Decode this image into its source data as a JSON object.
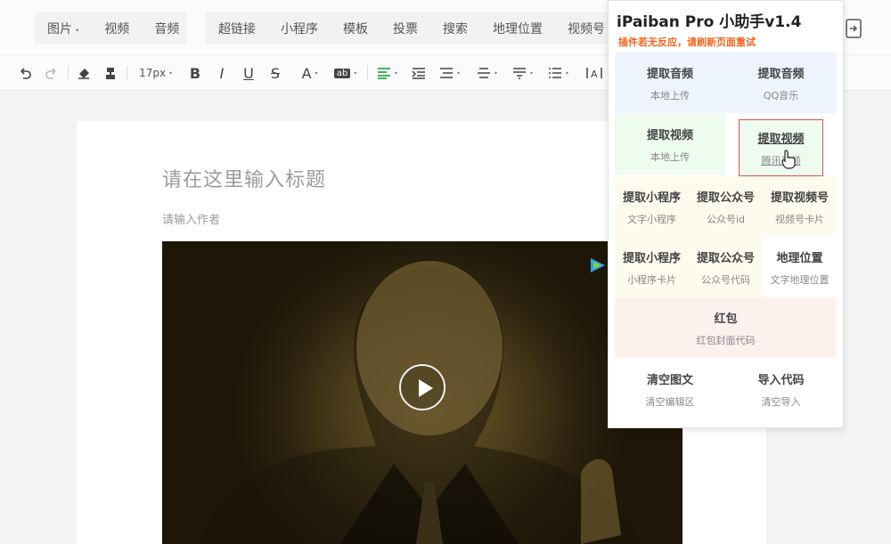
{
  "topbar": {
    "group1": [
      {
        "label": "图片",
        "dropdown": true
      },
      {
        "label": "视频",
        "dropdown": false
      },
      {
        "label": "音频",
        "dropdown": false
      }
    ],
    "group2": [
      {
        "label": "超链接"
      },
      {
        "label": "小程序"
      },
      {
        "label": "模板"
      },
      {
        "label": "投票"
      },
      {
        "label": "搜索"
      },
      {
        "label": "地理位置"
      },
      {
        "label": "视频号"
      }
    ],
    "right_icon": "document-icon"
  },
  "format_toolbar": {
    "font_size": "17px",
    "bold": "B",
    "italic": "I",
    "underline": "U",
    "strike": "S",
    "font_color": "A",
    "highlight": "ab"
  },
  "editor": {
    "title_placeholder": "请在这里输入标题",
    "author_placeholder": "请输入作者"
  },
  "popup": {
    "title": "iPaiban Pro 小助手v1.4",
    "warning": "插件若无反应，请刷新页面重试",
    "warning_color": "#f0641e",
    "rows": [
      [
        {
          "main": "提取音频",
          "sub": "本地上传"
        },
        {
          "main": "提取音频",
          "sub": "QQ音乐"
        }
      ],
      [
        {
          "main": "提取视频",
          "sub": "本地上传"
        },
        {
          "main": "提取视频",
          "sub": "腾讯视频"
        }
      ],
      [
        {
          "main": "提取小程序",
          "sub": "文字小程序"
        },
        {
          "main": "提取公众号",
          "sub": "公众号id"
        },
        {
          "main": "提取视频号",
          "sub": "视频号卡片"
        }
      ],
      [
        {
          "main": "提取小程序",
          "sub": "小程序卡片"
        },
        {
          "main": "提取公众号",
          "sub": "公众号代码"
        },
        {
          "main": "地理位置",
          "sub": "文字地理位置"
        }
      ],
      [
        {
          "main": "红包",
          "sub": "红包封面代码"
        }
      ],
      [
        {
          "main": "清空图文",
          "sub": "清空编辑区"
        },
        {
          "main": "导入代码",
          "sub": "清空导入"
        }
      ]
    ]
  }
}
